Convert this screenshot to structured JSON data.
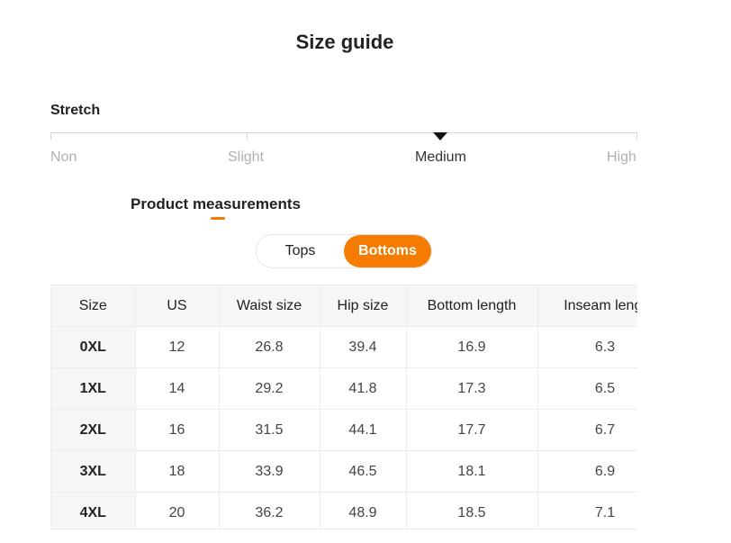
{
  "title": "Size guide",
  "stretch": {
    "label": "Stretch",
    "levels": [
      "Non",
      "Slight",
      "Medium",
      "High"
    ],
    "selected": "Medium"
  },
  "tabs": {
    "product_measurements": "Product measurements"
  },
  "toggle": {
    "tops": "Tops",
    "bottoms": "Bottoms",
    "active": "Bottoms"
  },
  "colors": {
    "accent": "#f57c00"
  },
  "table": {
    "headers": [
      "Size",
      "US",
      "Waist size",
      "Hip size",
      "Bottom length",
      "Inseam lengt"
    ],
    "rows": [
      [
        "0XL",
        "12",
        "26.8",
        "39.4",
        "16.9",
        "6.3"
      ],
      [
        "1XL",
        "14",
        "29.2",
        "41.8",
        "17.3",
        "6.5"
      ],
      [
        "2XL",
        "16",
        "31.5",
        "44.1",
        "17.7",
        "6.7"
      ],
      [
        "3XL",
        "18",
        "33.9",
        "46.5",
        "18.1",
        "6.9"
      ],
      [
        "4XL",
        "20",
        "36.2",
        "48.9",
        "18.5",
        "7.1"
      ]
    ]
  }
}
